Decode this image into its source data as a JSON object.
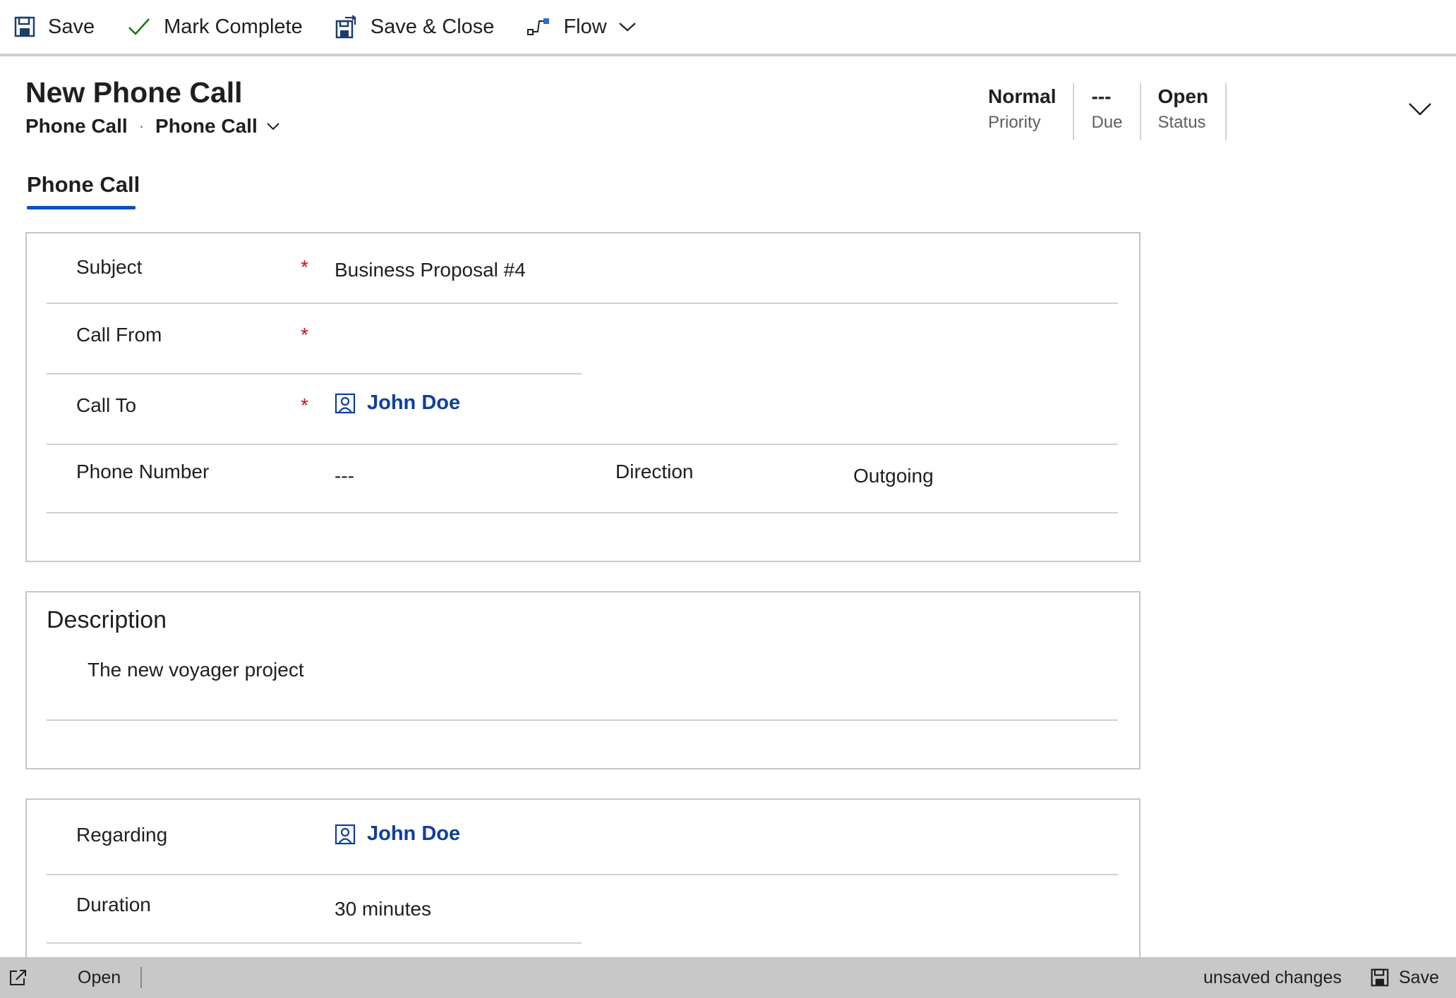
{
  "toolbar": {
    "save_label": "Save",
    "mark_complete_label": "Mark Complete",
    "save_close_label": "Save & Close",
    "flow_label": "Flow"
  },
  "header": {
    "title": "New Phone Call",
    "entity": "Phone Call",
    "form_name": "Phone Call",
    "fields": [
      {
        "value": "Normal",
        "label": "Priority"
      },
      {
        "value": "---",
        "label": "Due"
      },
      {
        "value": "Open",
        "label": "Status"
      }
    ]
  },
  "tabs": [
    {
      "label": "Phone Call"
    }
  ],
  "main_section": {
    "subject": {
      "label": "Subject",
      "required": "*",
      "value": "Business Proposal #4"
    },
    "call_from": {
      "label": "Call From",
      "required": "*",
      "value": ""
    },
    "call_to": {
      "label": "Call To",
      "required": "*",
      "value": "John Doe"
    },
    "phone_number": {
      "label": "Phone Number",
      "value": "---"
    },
    "direction": {
      "label": "Direction",
      "value": "Outgoing"
    }
  },
  "description_section": {
    "title": "Description",
    "value": "The new voyager project"
  },
  "details_section": {
    "regarding": {
      "label": "Regarding",
      "value": "John Doe"
    },
    "duration": {
      "label": "Duration",
      "value": "30 minutes"
    }
  },
  "statusbar": {
    "status": "Open",
    "unsaved": "unsaved changes",
    "save_label": "Save"
  },
  "colors": {
    "accent": "#0f4fc4",
    "lookup_link": "#0f3f9b",
    "required": "#c50f1f",
    "statusbar_bg": "#c8c8c8"
  }
}
